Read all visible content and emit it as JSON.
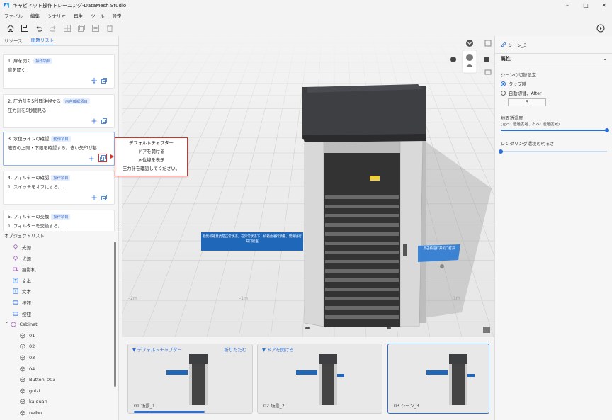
{
  "window": {
    "title": "キャビネット操作トレーニング-DataMesh Studio"
  },
  "menu": [
    "ファイル",
    "編集",
    "シナリオ",
    "再生",
    "ツール",
    "設定"
  ],
  "left_panel": {
    "tabs": [
      {
        "label": "リソース",
        "active": false
      },
      {
        "label": "問題リスト",
        "active": true
      }
    ],
    "tasks": [
      {
        "title": "1. 扉を開く",
        "badge": "操作項目",
        "desc": "扉を開く"
      },
      {
        "title": "2. 圧力計を5秒間注視する",
        "badge": "内容確認項目",
        "desc": "圧力計を5秒間見る"
      },
      {
        "title": "3. 水位ラインの確認",
        "badge": "動作項目",
        "desc": "液面の上限・下限を確認する。赤い矢印が基…"
      },
      {
        "title": "4. フィルターの確認",
        "badge": "操作項目",
        "desc": "1. スイッチをオフにする。…"
      },
      {
        "title": "5. フィルターの交換",
        "badge": "操作項目",
        "desc": "1. フィルターを交換する。…"
      }
    ],
    "object_list_header": "オブジェクトリスト",
    "objects": [
      {
        "label": "光源",
        "icon": "bulb-icon",
        "level": 1
      },
      {
        "label": "光源",
        "icon": "bulb-icon",
        "level": 1
      },
      {
        "label": "摄影机",
        "icon": "camera-icon",
        "level": 1
      },
      {
        "label": "文本",
        "icon": "text-icon",
        "level": 1
      },
      {
        "label": "文本",
        "icon": "text-icon",
        "level": 1
      },
      {
        "label": "按钮",
        "icon": "button-icon",
        "level": 1
      },
      {
        "label": "按钮",
        "icon": "button-icon",
        "level": 1
      },
      {
        "label": "Cabinet",
        "icon": "model-icon",
        "level": 0
      },
      {
        "label": "01",
        "icon": "cube-icon",
        "level": 2
      },
      {
        "label": "02",
        "icon": "cube-icon",
        "level": 2
      },
      {
        "label": "03",
        "icon": "cube-icon",
        "level": 2
      },
      {
        "label": "04",
        "icon": "cube-icon",
        "level": 2
      },
      {
        "label": "Button_003",
        "icon": "cube-icon",
        "level": 2
      },
      {
        "label": "guizi",
        "icon": "cube-icon",
        "level": 2
      },
      {
        "label": "kaiguan",
        "icon": "cube-icon",
        "level": 2
      },
      {
        "label": "neibu",
        "icon": "cube-icon",
        "level": 2
      }
    ]
  },
  "popup": {
    "items": [
      "デフォルトチャプター",
      "ドアを開ける",
      "水位線を表示",
      "圧力計を確認してください。"
    ]
  },
  "viewport": {
    "sign_text_1": "检集机箱意类是正常状态，在异常状态下，机箱会进行预警，需要进行开门检查",
    "sign_text_2": "点击按钮打开机门打开",
    "axis_labels": [
      "-2m",
      "-1m",
      "1m"
    ]
  },
  "scenes": [
    {
      "chapter": "デフォルトチャプター",
      "fold": "折りたたむ",
      "label": "01 场景_1",
      "active": false
    },
    {
      "chapter": "ドアを開ける",
      "fold": "",
      "label": "02 场景_2",
      "active": false
    },
    {
      "chapter": "",
      "fold": "",
      "label": "03 シーン_3",
      "active": true
    }
  ],
  "right_panel": {
    "scene_name": "シーン_3",
    "prop_header": "属性",
    "switch_label": "シーンの切替設定",
    "radio_tap": "タップ時",
    "radio_auto": "自動切替、After",
    "auto_value": "5",
    "ground_label": "地面透過度",
    "ground_hint": "(左へ: 透過度増、右へ: 透過度減)",
    "ground_value": 1.0,
    "light_label": "レンダリング環境の明るさ",
    "light_value": 0.0
  },
  "colors": {
    "accent": "#2b6fd6",
    "highlight": "#d93025"
  }
}
